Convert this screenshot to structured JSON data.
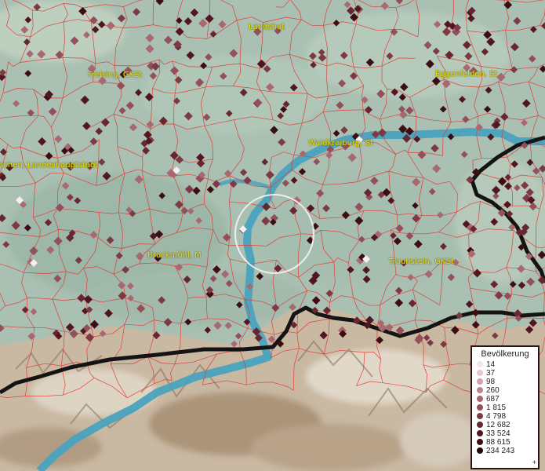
{
  "places": [
    {
      "name": "Landshut"
    },
    {
      "name": "Freising, GKSt"
    },
    {
      "name": "Eggenfelden, St"
    },
    {
      "name": "Waldkraiburg, St"
    },
    {
      "name": "nchen, Landeshauptstadt"
    },
    {
      "name": "Bruckmühl, M"
    },
    {
      "name": "Traunstein, GKSt"
    }
  ],
  "legend": {
    "title": "Bevölkerung",
    "items": [
      {
        "label": "14",
        "color": "#f5e4ea"
      },
      {
        "label": "37",
        "color": "#e7c8d0"
      },
      {
        "label": "98",
        "color": "#d2a3ac"
      },
      {
        "label": "260",
        "color": "#bd838b"
      },
      {
        "label": "687",
        "color": "#a86870"
      },
      {
        "label": "1 815",
        "color": "#93505a"
      },
      {
        "label": "4 798",
        "color": "#7d3a44"
      },
      {
        "label": "12 682",
        "color": "#682630"
      },
      {
        "label": "33 524",
        "color": "#521620"
      },
      {
        "label": "88 615",
        "color": "#3d0d14"
      },
      {
        "label": "234 243",
        "color": "#240609"
      }
    ],
    "overflow_mark": "+"
  },
  "colors": {
    "river": "#4aa2be",
    "border": "#141414",
    "admin_lines": "#e23a34",
    "label": "#e8e400"
  }
}
